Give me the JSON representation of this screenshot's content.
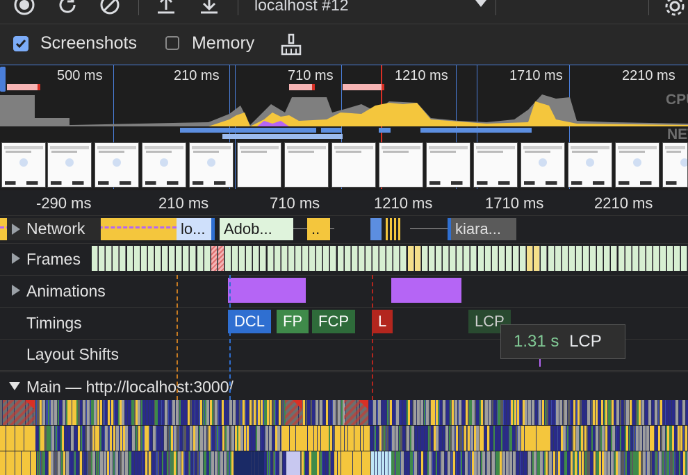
{
  "toolbar": {
    "target": "localhost #12",
    "icons": [
      "record-icon",
      "reload-icon",
      "clear-icon",
      "upload-icon",
      "download-icon",
      "settings-gear-icon"
    ]
  },
  "options": {
    "screenshots_label": "Screenshots",
    "screenshots_checked": true,
    "memory_label": "Memory",
    "memory_checked": false,
    "gc_icon": "broom-icon"
  },
  "overview": {
    "ticks": [
      "500 ms",
      "210 ms",
      "710 ms",
      "1210 ms",
      "1710 ms",
      "2210 ms"
    ],
    "cpu_label": "CPU",
    "net_label": "NET"
  },
  "ruler": {
    "ticks": [
      "-290 ms",
      "210 ms",
      "710 ms",
      "1210 ms",
      "1710 ms",
      "2210 ms"
    ]
  },
  "tracks": {
    "network": {
      "label": "Network",
      "requests": [
        "lo...",
        "Adob...",
        "..",
        "kiara..."
      ]
    },
    "frames": {
      "label": "Frames"
    },
    "animations": {
      "label": "Animations"
    },
    "timings": {
      "label": "Timings",
      "markers": [
        "DCL",
        "FP",
        "FCP",
        "L",
        "LCP"
      ]
    },
    "layout_shifts": {
      "label": "Layout Shifts"
    },
    "main": {
      "label": "Main — http://localhost:3000/"
    }
  },
  "tooltip": {
    "value": "1.31 s",
    "name": "LCP"
  },
  "colors": {
    "accent_blue": "#4a7ed9",
    "scripting_yellow": "#f4c63d",
    "rendering_purple": "#b565f5",
    "painting_green": "#3f8a4a",
    "dcl_blue": "#2f6fd1",
    "load_red": "#b3261e"
  }
}
